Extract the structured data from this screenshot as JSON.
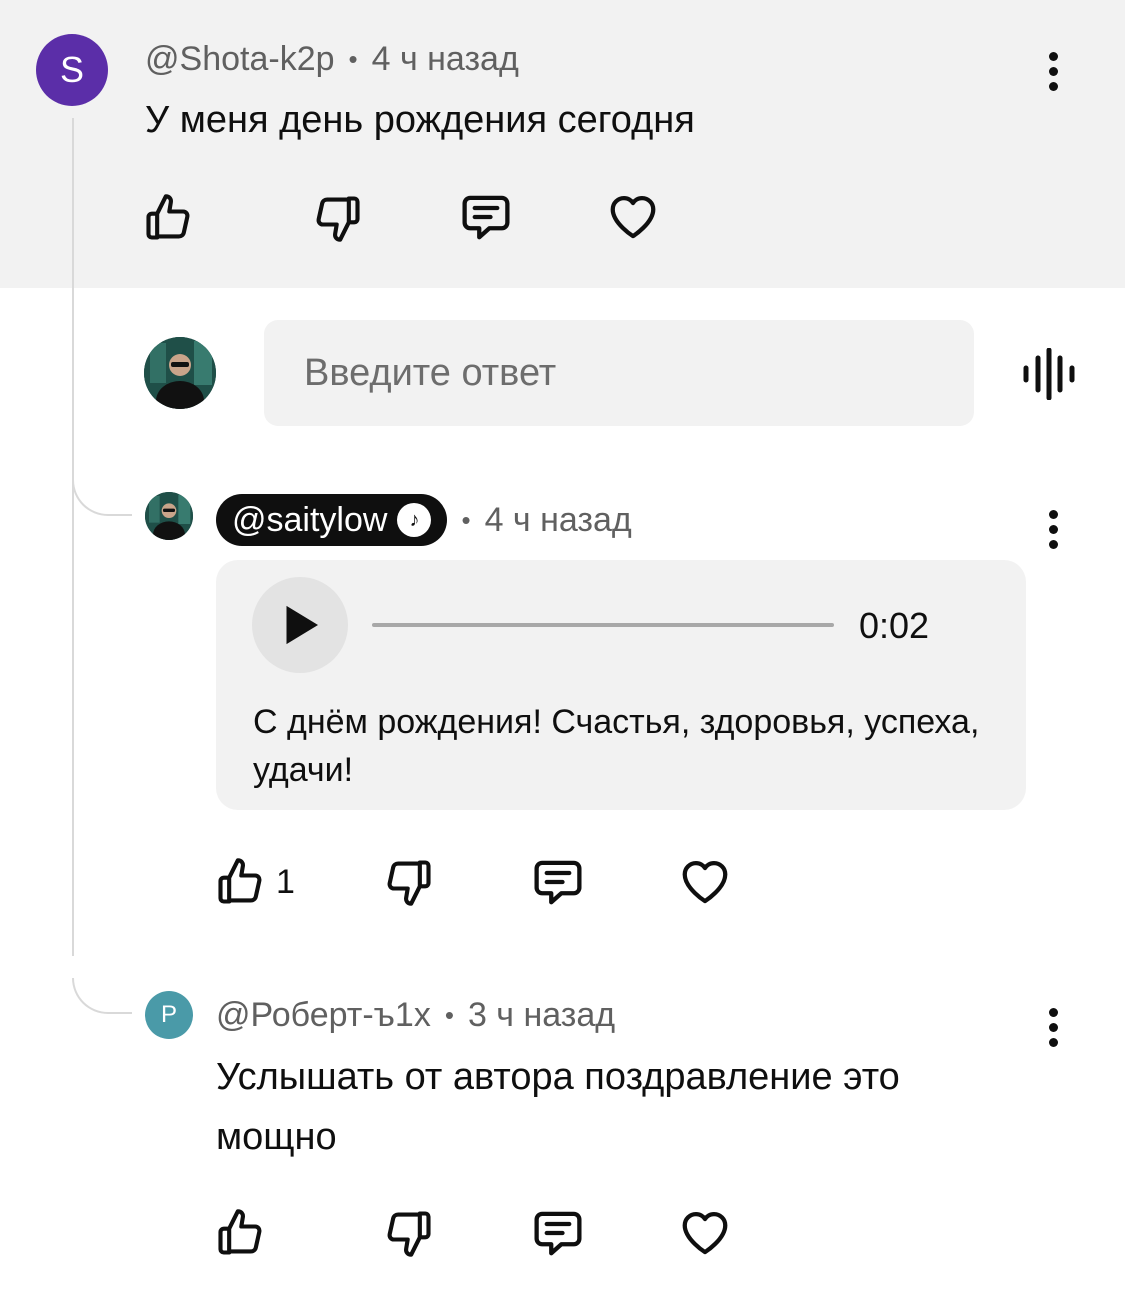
{
  "parent": {
    "avatar_letter": "S",
    "avatar_color": "#5b2ea8",
    "author": "@Shota-k2p",
    "separator": "•",
    "time": "4 ч назад",
    "text": "У меня день рождения сегодня"
  },
  "reply_input": {
    "placeholder": "Введите ответ"
  },
  "voice_reply": {
    "author": "@saitylow",
    "separator": "•",
    "time": "4 ч назад",
    "duration": "0:02",
    "progress": 0,
    "transcript": "С днём рождения! Счастья, здоровья, успеха, удачи!",
    "like_count": "1"
  },
  "reply2": {
    "avatar_letter": "Р",
    "avatar_color": "#4a9aa8",
    "author": "@Роберт-ъ1x",
    "separator": "•",
    "time": "3 ч назад",
    "text": "Услышать от автора поздравление это мощно"
  },
  "icons": {
    "like": "thumbs-up-icon",
    "dislike": "thumbs-down-icon",
    "reply": "comment-icon",
    "heart": "heart-icon",
    "more": "more-vertical-icon",
    "mic": "voice-wave-icon",
    "play": "play-icon"
  }
}
